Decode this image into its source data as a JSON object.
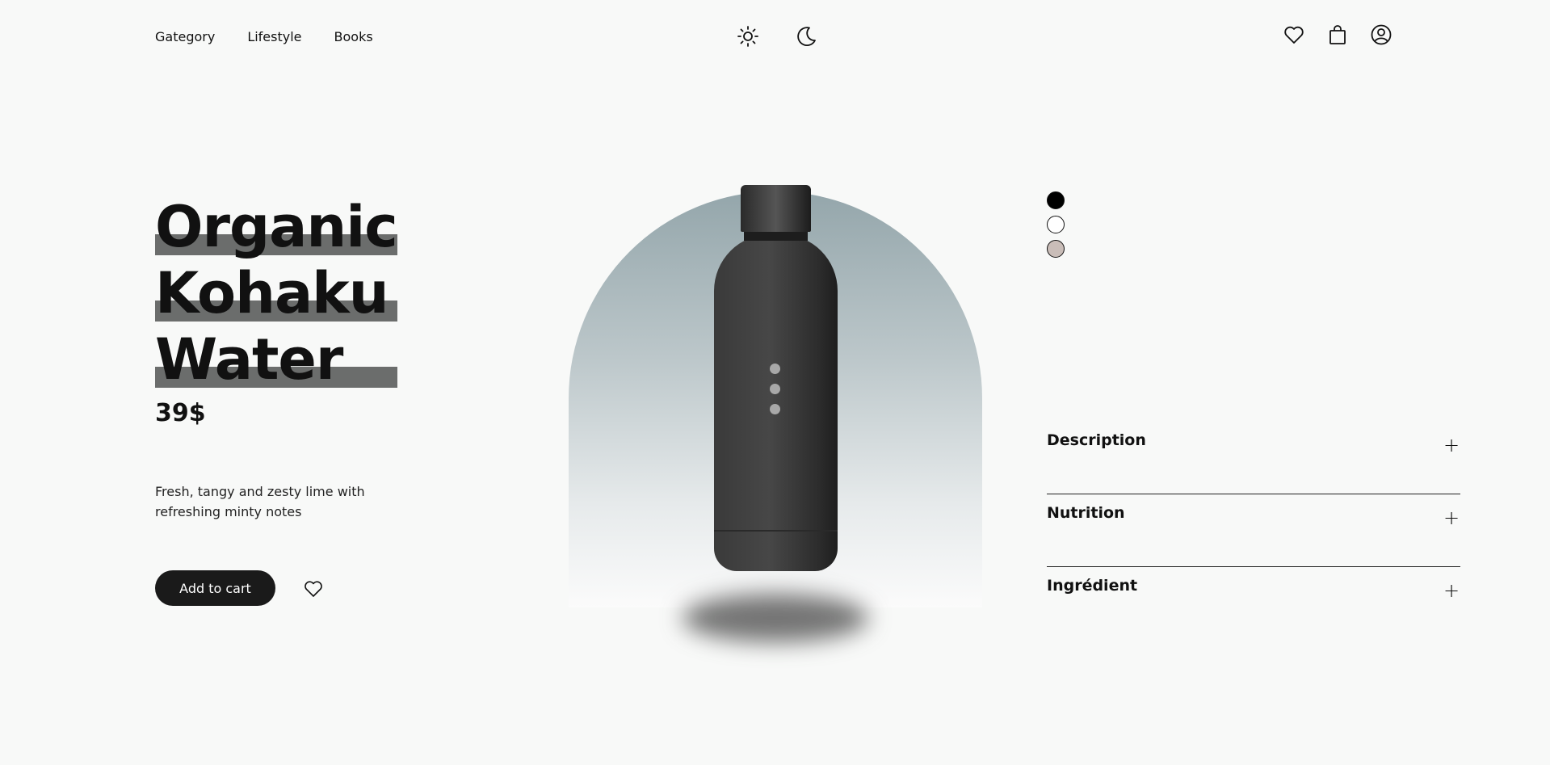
{
  "nav": {
    "items": [
      {
        "label": "Gategory"
      },
      {
        "label": "Lifestyle"
      },
      {
        "label": "Books"
      }
    ]
  },
  "theme": {
    "light_icon": "sun-icon",
    "dark_icon": "moon-icon"
  },
  "header_icons": [
    "heart-icon",
    "shopping-bag-icon",
    "user-account-icon"
  ],
  "product": {
    "title_lines": [
      "Organic",
      "Kohaku",
      "Water"
    ],
    "price": "39$",
    "description": "Fresh, tangy and zesty lime with refreshing minty notes",
    "add_to_cart_label": "Add to cart",
    "bottle_color": "#333333"
  },
  "colors": {
    "highlight": "#6b6d6c",
    "swatches": [
      "#000000",
      "#ffffff",
      "#c9bdb8"
    ],
    "selected_swatch_index": 0
  },
  "accordion": [
    {
      "label": "Description",
      "icon": "plus-icon"
    },
    {
      "label": "Nutrition",
      "icon": "plus-icon"
    },
    {
      "label": "Ingrédient",
      "icon": "plus-icon"
    }
  ],
  "image_pagination": {
    "count": 3
  }
}
